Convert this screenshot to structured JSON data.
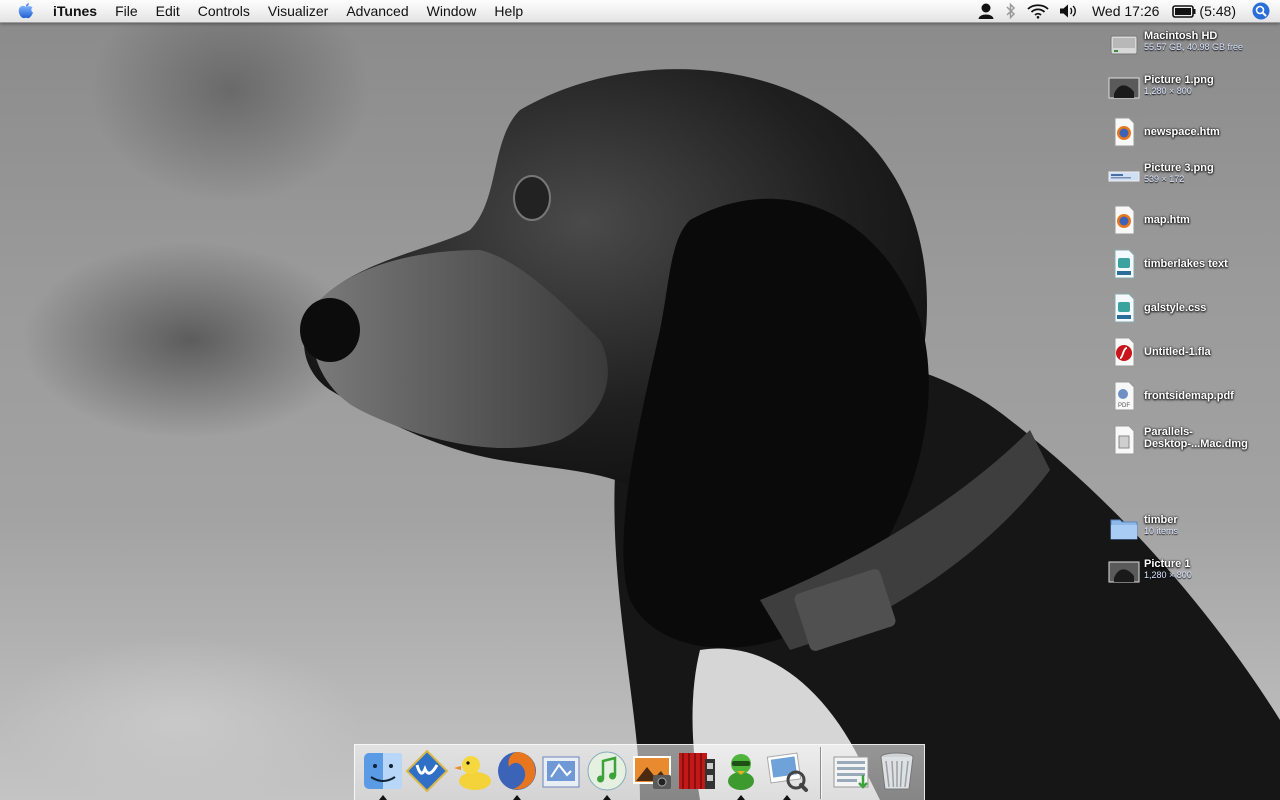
{
  "menubar": {
    "app_name": "iTunes",
    "menus": [
      "File",
      "Edit",
      "Controls",
      "Visualizer",
      "Advanced",
      "Window",
      "Help"
    ],
    "clock": "Wed 17:26",
    "battery": "(5:48)"
  },
  "desktop": {
    "items": [
      {
        "name": "Macintosh HD",
        "detail": "55.57 GB, 40.98 GB free",
        "icon": "hard-drive-icon"
      },
      {
        "name": "Picture 1.png",
        "detail": "1,280 × 800",
        "icon": "image-thumbnail-icon"
      },
      {
        "name": "newspace.htm",
        "detail": "",
        "icon": "firefox-document-icon"
      },
      {
        "name": "Picture 3.png",
        "detail": "539 × 172",
        "icon": "image-thumbnail-icon"
      },
      {
        "name": "map.htm",
        "detail": "",
        "icon": "firefox-document-icon"
      },
      {
        "name": "timberlakes text",
        "detail": "",
        "icon": "text-document-icon"
      },
      {
        "name": "galstyle.css",
        "detail": "",
        "icon": "text-document-icon"
      },
      {
        "name": "Untitled-1.fla",
        "detail": "",
        "icon": "flash-document-icon"
      },
      {
        "name": "frontsidemap.pdf",
        "detail": "",
        "icon": "pdf-document-icon"
      },
      {
        "name": "Parallels-",
        "detail": "Desktop-...Mac.dmg",
        "icon": "disk-image-icon"
      },
      {
        "name": "timber",
        "detail": "10 items",
        "icon": "folder-icon"
      },
      {
        "name": "Picture 1",
        "detail": "1,280 × 800",
        "icon": "image-thumbnail-icon"
      }
    ]
  },
  "dock": {
    "apps": [
      {
        "name": "Finder",
        "icon": "finder-icon",
        "running": true
      },
      {
        "name": "Dashboard",
        "icon": "dashboard-icon",
        "running": false
      },
      {
        "name": "Adium",
        "icon": "adium-duck-icon",
        "running": false
      },
      {
        "name": "Firefox",
        "icon": "firefox-icon",
        "running": true
      },
      {
        "name": "Mail",
        "icon": "mail-icon",
        "running": false
      },
      {
        "name": "iTunes",
        "icon": "itunes-icon",
        "running": true
      },
      {
        "name": "iPhoto",
        "icon": "iphoto-icon",
        "running": false
      },
      {
        "name": "Front Row",
        "icon": "front-row-icon",
        "running": false
      },
      {
        "name": "Cyberduck",
        "icon": "cyberduck-icon",
        "running": true
      },
      {
        "name": "Preview",
        "icon": "preview-icon",
        "running": true
      },
      {
        "name": "Downloads",
        "icon": "downloads-stack-icon",
        "running": false
      },
      {
        "name": "Trash",
        "icon": "trash-icon",
        "running": false
      }
    ]
  },
  "colors": {
    "menubar_text": "#111111",
    "desktop_label": "#ffffff",
    "spotlight_blue": "#2a6fd8"
  }
}
